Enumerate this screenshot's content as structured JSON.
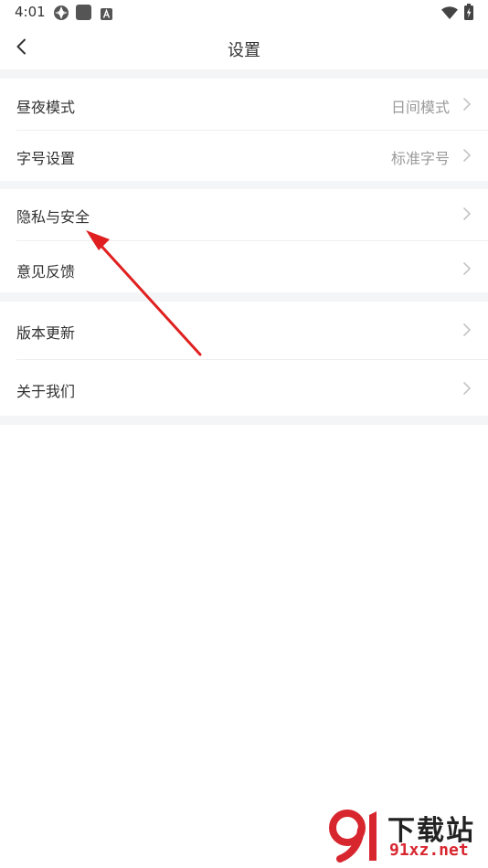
{
  "status_bar": {
    "time": "4:01"
  },
  "header": {
    "title": "设置",
    "back_icon": "chevron-left-icon"
  },
  "groups": [
    {
      "items": [
        {
          "label": "昼夜模式",
          "value": "日间模式"
        },
        {
          "label": "字号设置",
          "value": "标准字号"
        }
      ]
    },
    {
      "items": [
        {
          "label": "隐私与安全",
          "value": ""
        },
        {
          "label": "意见反馈",
          "value": ""
        }
      ]
    },
    {
      "items": [
        {
          "label": "版本更新",
          "value": ""
        },
        {
          "label": "关于我们",
          "value": ""
        }
      ]
    }
  ],
  "annotation": {
    "color": "#e02020",
    "points_to": "隐私与安全"
  },
  "watermark": {
    "title": "下载站",
    "domain": "91xz.net",
    "accent": "#d8262f"
  },
  "colors": {
    "text": "#333333",
    "muted": "#9a9a9a",
    "section_gap": "#f4f5f7",
    "divider": "#eeeeee"
  }
}
